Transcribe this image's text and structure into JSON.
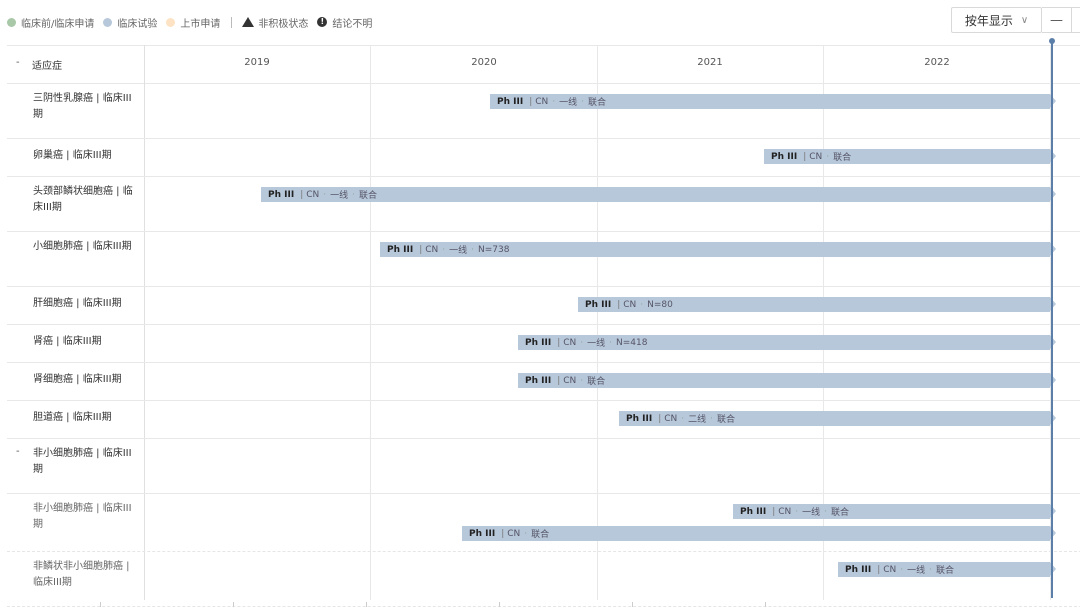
{
  "legend": [
    {
      "label": "临床前/临床申请",
      "color": "#a8c8a8"
    },
    {
      "label": "临床试验",
      "color": "#b8c8db"
    },
    {
      "label": "上市申请",
      "color": "#fde3c4"
    }
  ],
  "legend_status": [
    {
      "label": "非积极状态",
      "icon": "triangle-icon"
    },
    {
      "label": "结论不明",
      "icon": "exclamation-icon"
    }
  ],
  "controls": {
    "view_select": "按年显示",
    "zoom_out": "—",
    "zoom_in": "+"
  },
  "header": {
    "collapse": "-",
    "column_label": "适应症",
    "years": [
      "2019",
      "2020",
      "2021",
      "2022"
    ]
  },
  "rows": [
    {
      "label": "三阴性乳腺癌 | 临床III期",
      "bars": [
        {
          "phase": "Ph III",
          "tags": [
            "CN",
            "一线",
            "联合"
          ]
        }
      ]
    },
    {
      "label": "卵巢癌 | 临床III期",
      "bars": [
        {
          "phase": "Ph III",
          "tags": [
            "CN",
            "联合"
          ]
        }
      ]
    },
    {
      "label": "头颈部鳞状细胞癌 | 临床III期",
      "bars": [
        {
          "phase": "Ph III",
          "tags": [
            "CN",
            "一线",
            "联合"
          ]
        }
      ]
    },
    {
      "label": "小细胞肺癌 | 临床III期",
      "bars": [
        {
          "phase": "Ph III",
          "tags": [
            "CN",
            "一线",
            "N=738"
          ]
        }
      ]
    },
    {
      "label": "肝细胞癌 | 临床III期",
      "bars": [
        {
          "phase": "Ph III",
          "tags": [
            "CN",
            "N=80"
          ]
        }
      ]
    },
    {
      "label": "肾癌 | 临床III期",
      "bars": [
        {
          "phase": "Ph III",
          "tags": [
            "CN",
            "一线",
            "N=418"
          ]
        }
      ]
    },
    {
      "label": "肾细胞癌 | 临床III期",
      "bars": [
        {
          "phase": "Ph III",
          "tags": [
            "CN",
            "联合"
          ]
        }
      ]
    },
    {
      "label": "胆道癌 | 临床III期",
      "bars": [
        {
          "phase": "Ph III",
          "tags": [
            "CN",
            "二线",
            "联合"
          ]
        }
      ]
    },
    {
      "label": "非小细胞肺癌 | 临床III期",
      "group": true,
      "collapse": "-",
      "bars": []
    },
    {
      "label": "非小细胞肺癌 | 临床III期",
      "sub": true,
      "bars": [
        {
          "phase": "Ph III",
          "tags": [
            "CN",
            "一线",
            "联合"
          ]
        },
        {
          "phase": "Ph III",
          "tags": [
            "CN",
            "联合"
          ]
        }
      ]
    },
    {
      "label": "非鳞状非小细胞肺癌 | 临床III期",
      "sub": true,
      "bars": [
        {
          "phase": "Ph III",
          "tags": [
            "CN",
            "一线",
            "联合"
          ]
        }
      ]
    }
  ]
}
